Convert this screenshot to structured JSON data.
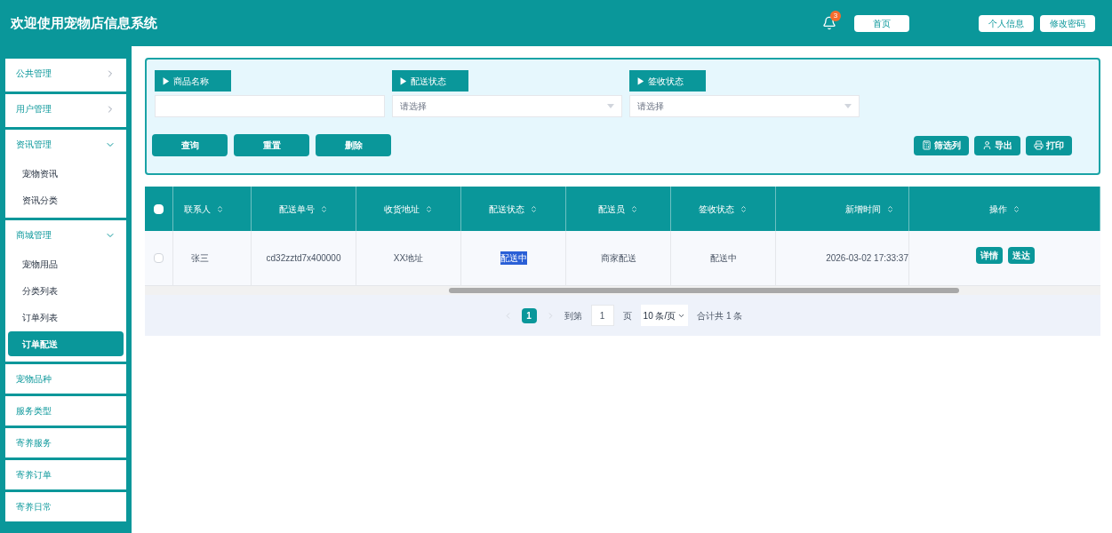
{
  "header": {
    "title": "欢迎使用宠物店信息系统",
    "notification_count": "3",
    "buttons": [
      "首页",
      "个人信息",
      "修改密码"
    ]
  },
  "sidebar": {
    "items": [
      {
        "kind": "group",
        "label": "公共管理",
        "expanded": false
      },
      {
        "kind": "group",
        "label": "用户管理",
        "expanded": false
      },
      {
        "kind": "group",
        "label": "资讯管理",
        "expanded": true,
        "children": [
          {
            "label": "宠物资讯",
            "selected": false
          },
          {
            "label": "资讯分类",
            "selected": false
          }
        ]
      },
      {
        "kind": "group",
        "label": "商城管理",
        "expanded": true,
        "children": [
          {
            "label": "宠物用品",
            "selected": false
          },
          {
            "label": "分类列表",
            "selected": false
          },
          {
            "label": "订单列表",
            "selected": false
          },
          {
            "label": "订单配送",
            "selected": true
          }
        ]
      },
      {
        "kind": "link",
        "label": "宠物品种"
      },
      {
        "kind": "link",
        "label": "服务类型"
      },
      {
        "kind": "link",
        "label": "寄养服务"
      },
      {
        "kind": "link",
        "label": "寄养订单"
      },
      {
        "kind": "link",
        "label": "寄养日常"
      }
    ]
  },
  "filters": [
    {
      "kind": "text",
      "label": "▶ 商品名称"
    },
    {
      "kind": "select",
      "label": "▶ 配送状态",
      "placeholder": "请选择"
    },
    {
      "kind": "select",
      "label": "▶ 签收状态",
      "placeholder": "请选择"
    }
  ],
  "actions": [
    "查询",
    "重置",
    "删除"
  ],
  "tools": [
    {
      "kind": "columns",
      "label": "筛选列"
    },
    {
      "kind": "export",
      "label": "导出"
    },
    {
      "kind": "print",
      "label": "打印"
    }
  ],
  "table": {
    "all_checked": false,
    "columns": [
      "联系人",
      "配送单号",
      "收货地址",
      "配送状态",
      "配送员",
      "签收状态",
      "新增时间",
      "操作"
    ],
    "rows": [
      {
        "checked": false,
        "cells": [
          {
            "text": "张三",
            "highlighted": false
          },
          {
            "text": "cd32zztd7x400000",
            "highlighted": false
          },
          {
            "text": "XX地址",
            "highlighted": false
          },
          {
            "text": "配送中",
            "highlighted": true
          },
          {
            "text": "商家配送",
            "highlighted": false
          },
          {
            "text": "配送中",
            "highlighted": false
          },
          {
            "text": "2026-03-02 17:33:37",
            "highlighted": false
          }
        ],
        "buttons": [
          "详情",
          "送达"
        ]
      }
    ]
  },
  "pagination": {
    "pages": [
      {
        "label": "1",
        "selected": true
      }
    ],
    "goto_label": "到第",
    "goto_value": "1",
    "page_unit": "页",
    "page_size": "10 条/页",
    "total": "合计共 1 条"
  }
}
